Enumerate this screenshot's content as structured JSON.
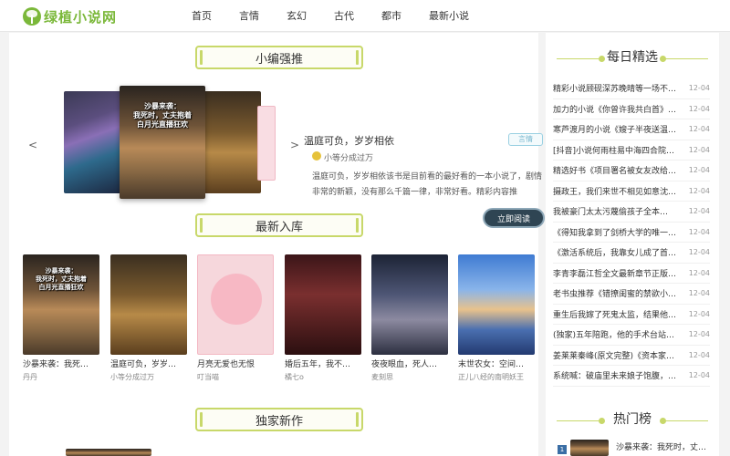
{
  "site": {
    "logo_text": "绿植小说网"
  },
  "nav": [
    "首页",
    "言情",
    "玄幻",
    "古代",
    "都市",
    "最新小说"
  ],
  "sections": {
    "editor": "小编强推",
    "latest": "最新入库",
    "exclusive": "独家新作"
  },
  "carousel": {
    "prev": "<",
    "next": ">",
    "cover_text": "沙暴来袭：\n我死时，丈夫抱着\n白月光直播狂欢",
    "featured": {
      "title": "温庭可负，岁岁相依",
      "tag": "言情",
      "author": "小等分成过万",
      "desc": "温庭可负，岁岁相依该书是目前看的最好看的一本小说了，剧情非常的新颖，没有那么千篇一律，非常好看。精彩内容推荐：“我们…",
      "read_label": "立即阅读"
    }
  },
  "latest_books": [
    {
      "title": "沙暴来袭：我死…",
      "author": "丹丹",
      "cover_text": "沙暴来袭：\n我死时，丈夫抱着\n白月光直播狂欢"
    },
    {
      "title": "温庭可负，岁岁…",
      "author": "小等分成过万",
      "cover_text": ""
    },
    {
      "title": "月亮无爱也无恨",
      "author": "叮当喵",
      "cover_text": ""
    },
    {
      "title": "婚后五年，我不…",
      "author": "橘七o",
      "cover_text": ""
    },
    {
      "title": "夜夜眼血，死人…",
      "author": "麦刻思",
      "cover_text": ""
    },
    {
      "title": "末世农女：空间…",
      "author": "正儿八经的南明妖王",
      "cover_text": ""
    }
  ],
  "sidebar": {
    "daily_title": "每日精选",
    "daily": [
      {
        "title": "精彩小说顾砚深苏晚晴等一场不…",
        "date": "12-04"
      },
      {
        "title": "加力的小说《你曾许我共白首》…",
        "date": "12-04"
      },
      {
        "title": "寒芦渡月的小说《嫂子半夜送温…",
        "date": "12-04"
      },
      {
        "title": "[抖音]小说何雨柱易中海四合院…",
        "date": "12-04"
      },
      {
        "title": "精选好书《项目署名被女友改给…",
        "date": "12-04"
      },
      {
        "title": "摄政王，我们来世不相见如意沈…",
        "date": "12-04"
      },
      {
        "title": "我被豪门太太污蔑偷孩子全本…",
        "date": "12-04"
      },
      {
        "title": "《得知我拿到了剑桥大学的唯一…",
        "date": "12-04"
      },
      {
        "title": "《激活系统后，我靠女儿成了首…",
        "date": "12-04"
      },
      {
        "title": "李青李磊江哲全文最新章节正版…",
        "date": "12-04"
      },
      {
        "title": "老书虫推荐《错撩闺蜜的禁欲小…",
        "date": "12-04"
      },
      {
        "title": "重生后我嫁了死鬼太监，结果他…",
        "date": "12-04"
      },
      {
        "title": "(独家)五年陪跑，他的手术台站…",
        "date": "12-04"
      },
      {
        "title": "姜莱莱秦峰(原文完整)《资本家…",
        "date": "12-04"
      },
      {
        "title": "系统喊：破庙里未来娘子饱腹，…",
        "date": "12-04"
      }
    ],
    "hot_title": "热门榜",
    "hot": [
      {
        "rank": "1",
        "title": "沙暴来袭：我死时，丈…"
      }
    ]
  },
  "colors": {
    "brand": "#7bb83a",
    "frame": "#c8d86a",
    "button": "#2f4553"
  }
}
